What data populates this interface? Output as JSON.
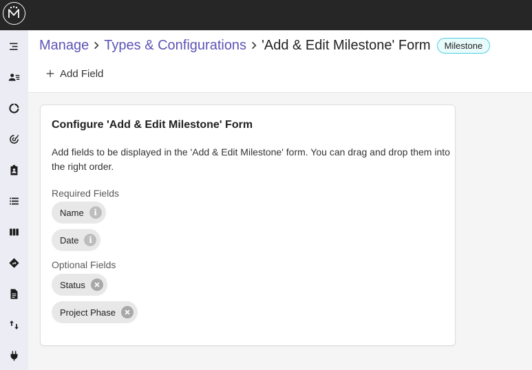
{
  "app": {
    "logo_icon": "app-logo-icon"
  },
  "sidebar": {
    "items": [
      {
        "icon": "menu-collapse-icon"
      },
      {
        "icon": "people-list-icon"
      },
      {
        "icon": "donut-chart-icon"
      },
      {
        "icon": "target-icon"
      },
      {
        "icon": "clipboard-person-icon"
      },
      {
        "icon": "list-icon"
      },
      {
        "icon": "columns-icon"
      },
      {
        "icon": "roadmap-icon"
      },
      {
        "icon": "document-icon"
      },
      {
        "icon": "swap-vertical-icon"
      },
      {
        "icon": "plug-icon"
      }
    ]
  },
  "breadcrumb": {
    "items": [
      "Manage",
      "Types & Configurations"
    ],
    "current": "'Add & Edit Milestone' Form",
    "badge": "Milestone"
  },
  "toolbar": {
    "add_field_label": "Add Field"
  },
  "card": {
    "title": "Configure 'Add & Edit Milestone' Form",
    "description": "Add fields to be displayed in the 'Add & Edit Milestone' form. You can drag and drop them into the right order.",
    "required_label": "Required Fields",
    "required_fields": [
      "Name",
      "Date"
    ],
    "optional_label": "Optional Fields",
    "optional_fields": [
      "Status",
      "Project Phase"
    ]
  },
  "colors": {
    "accent": "#5c54b5",
    "topbar": "#262626",
    "sidebar": "#ececf4",
    "badge_border": "#4dd0e1"
  }
}
